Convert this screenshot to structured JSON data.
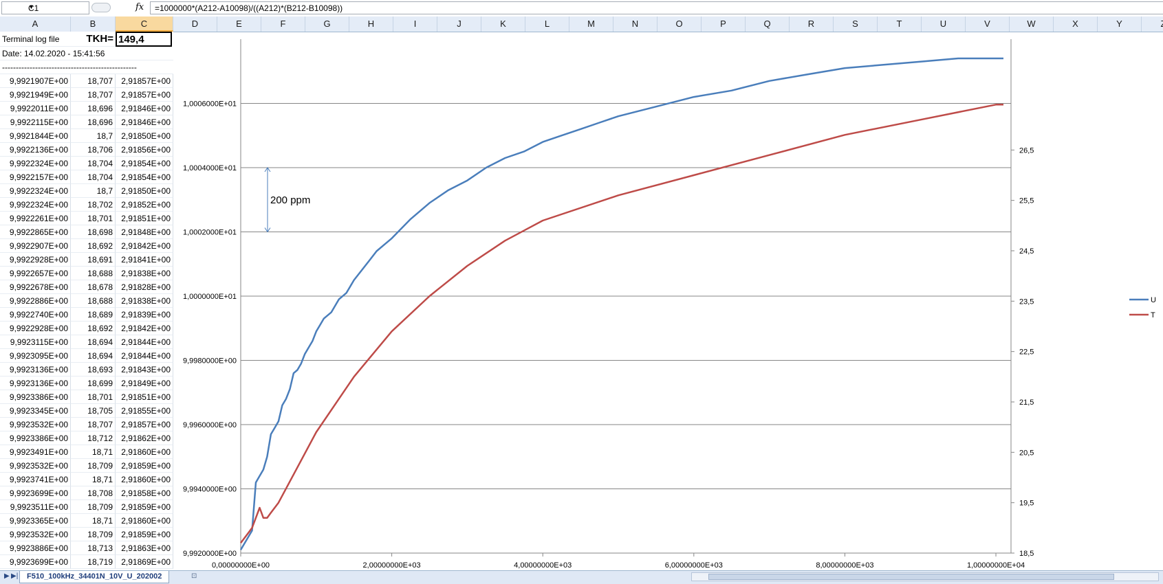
{
  "formula_bar": {
    "name_box": "C1",
    "fx": "fx",
    "formula": "=1000000*(A212-A10098)/((A212)*(B212-B10098))"
  },
  "columns": [
    "A",
    "B",
    "C",
    "D",
    "E",
    "F",
    "G",
    "H",
    "I",
    "J",
    "K",
    "L",
    "M",
    "N",
    "O",
    "P",
    "Q",
    "R",
    "S",
    "T",
    "U",
    "V",
    "W",
    "X",
    "Y",
    "Z"
  ],
  "selected_column": "C",
  "header_rows": {
    "a1": "Terminal log file",
    "b1": "TKH=",
    "c1": "149,4",
    "a2": "Date: 14.02.2020 - 15:41:56",
    "a3": "-------------------------------------------------"
  },
  "rows": [
    [
      "9,9921907E+00",
      "18,707",
      "2,91857E+00"
    ],
    [
      "9,9921949E+00",
      "18,707",
      "2,91857E+00"
    ],
    [
      "9,9922011E+00",
      "18,696",
      "2,91846E+00"
    ],
    [
      "9,9922115E+00",
      "18,696",
      "2,91846E+00"
    ],
    [
      "9,9921844E+00",
      "18,7",
      "2,91850E+00"
    ],
    [
      "9,9922136E+00",
      "18,706",
      "2,91856E+00"
    ],
    [
      "9,9922324E+00",
      "18,704",
      "2,91854E+00"
    ],
    [
      "9,9922157E+00",
      "18,704",
      "2,91854E+00"
    ],
    [
      "9,9922324E+00",
      "18,7",
      "2,91850E+00"
    ],
    [
      "9,9922324E+00",
      "18,702",
      "2,91852E+00"
    ],
    [
      "9,9922261E+00",
      "18,701",
      "2,91851E+00"
    ],
    [
      "9,9922865E+00",
      "18,698",
      "2,91848E+00"
    ],
    [
      "9,9922907E+00",
      "18,692",
      "2,91842E+00"
    ],
    [
      "9,9922928E+00",
      "18,691",
      "2,91841E+00"
    ],
    [
      "9,9922657E+00",
      "18,688",
      "2,91838E+00"
    ],
    [
      "9,9922678E+00",
      "18,678",
      "2,91828E+00"
    ],
    [
      "9,9922886E+00",
      "18,688",
      "2,91838E+00"
    ],
    [
      "9,9922740E+00",
      "18,689",
      "2,91839E+00"
    ],
    [
      "9,9922928E+00",
      "18,692",
      "2,91842E+00"
    ],
    [
      "9,9923115E+00",
      "18,694",
      "2,91844E+00"
    ],
    [
      "9,9923095E+00",
      "18,694",
      "2,91844E+00"
    ],
    [
      "9,9923136E+00",
      "18,693",
      "2,91843E+00"
    ],
    [
      "9,9923136E+00",
      "18,699",
      "2,91849E+00"
    ],
    [
      "9,9923386E+00",
      "18,701",
      "2,91851E+00"
    ],
    [
      "9,9923345E+00",
      "18,705",
      "2,91855E+00"
    ],
    [
      "9,9923532E+00",
      "18,707",
      "2,91857E+00"
    ],
    [
      "9,9923386E+00",
      "18,712",
      "2,91862E+00"
    ],
    [
      "9,9923491E+00",
      "18,71",
      "2,91860E+00"
    ],
    [
      "9,9923532E+00",
      "18,709",
      "2,91859E+00"
    ],
    [
      "9,9923741E+00",
      "18,71",
      "2,91860E+00"
    ],
    [
      "9,9923699E+00",
      "18,708",
      "2,91858E+00"
    ],
    [
      "9,9923511E+00",
      "18,709",
      "2,91859E+00"
    ],
    [
      "9,9923365E+00",
      "18,71",
      "2,91860E+00"
    ],
    [
      "9,9923532E+00",
      "18,709",
      "2,91859E+00"
    ],
    [
      "9,9923886E+00",
      "18,713",
      "2,91863E+00"
    ],
    [
      "9,9923699E+00",
      "18,719",
      "2,91869E+00"
    ]
  ],
  "chart_data": {
    "type": "line",
    "y_left_ticks": [
      "9,9920000E+00",
      "9,9940000E+00",
      "9,9960000E+00",
      "9,9980000E+00",
      "1,0000000E+01",
      "1,0002000E+01",
      "1,0004000E+01",
      "1,0006000E+01"
    ],
    "y_left_range": [
      9.992,
      10.008
    ],
    "y_right_ticks": [
      "18,5",
      "19,5",
      "20,5",
      "21,5",
      "22,5",
      "23,5",
      "24,5",
      "25,5",
      "26,5"
    ],
    "y_right_range": [
      18.5,
      28.7
    ],
    "x_ticks": [
      "0,00000000E+00",
      "2,00000000E+03",
      "4,00000000E+03",
      "6,00000000E+03",
      "8,00000000E+03",
      "1,00000000E+04"
    ],
    "x_range": [
      0,
      10200
    ],
    "annotation": "200 ppm",
    "series": [
      {
        "name": "U",
        "color": "#4a7ebb",
        "axis": "left",
        "x": [
          0,
          150,
          200,
          250,
          300,
          350,
          400,
          450,
          500,
          550,
          600,
          650,
          700,
          750,
          800,
          850,
          900,
          950,
          1000,
          1050,
          1100,
          1200,
          1300,
          1400,
          1500,
          1600,
          1700,
          1800,
          1900,
          2000,
          2250,
          2500,
          2750,
          3000,
          3250,
          3500,
          3750,
          4000,
          4250,
          4500,
          4750,
          5000,
          5500,
          6000,
          6500,
          7000,
          7500,
          8000,
          8500,
          9000,
          9500,
          10000,
          10100
        ],
        "y": [
          9.9921,
          9.9927,
          9.9942,
          9.9944,
          9.9946,
          9.995,
          9.9957,
          9.9959,
          9.9961,
          9.9966,
          9.9968,
          9.9971,
          9.9976,
          9.9977,
          9.9979,
          9.9982,
          9.9984,
          9.9986,
          9.9989,
          9.9991,
          9.9993,
          9.9995,
          9.9999,
          10.0001,
          10.0005,
          10.0008,
          10.0011,
          10.0014,
          10.0016,
          10.0018,
          10.0024,
          10.0029,
          10.0033,
          10.0036,
          10.004,
          10.0043,
          10.0045,
          10.0048,
          10.005,
          10.0052,
          10.0054,
          10.0056,
          10.0059,
          10.0062,
          10.0064,
          10.0067,
          10.0069,
          10.0071,
          10.0072,
          10.0073,
          10.0074,
          10.0074,
          10.0074
        ]
      },
      {
        "name": "T",
        "color": "#be4b48",
        "axis": "right",
        "x": [
          0,
          100,
          150,
          200,
          250,
          300,
          350,
          400,
          500,
          750,
          1000,
          1500,
          2000,
          2500,
          3000,
          3500,
          4000,
          5000,
          6000,
          7000,
          8000,
          9000,
          10000,
          10100
        ],
        "y": [
          18.7,
          18.9,
          19.0,
          19.2,
          19.4,
          19.2,
          19.2,
          19.3,
          19.5,
          20.2,
          20.9,
          22.0,
          22.9,
          23.6,
          24.2,
          24.7,
          25.1,
          25.6,
          26.0,
          26.4,
          26.8,
          27.1,
          27.4,
          27.4
        ]
      }
    ]
  }
}
